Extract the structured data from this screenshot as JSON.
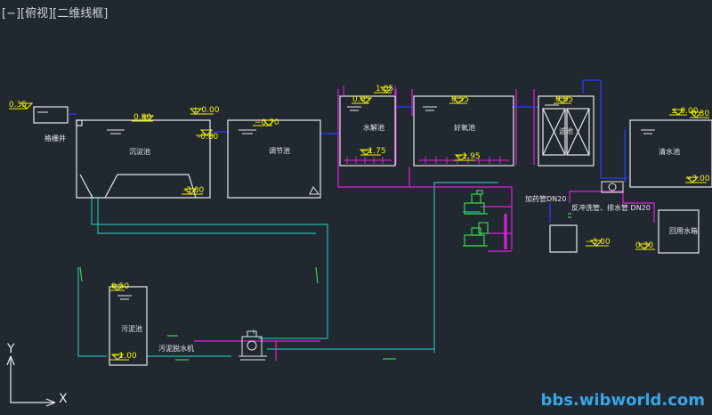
{
  "viewport": {
    "label": "[−][俯视][二维线框]"
  },
  "watermark": "bbs.wibworld.com",
  "ucs": {
    "x_label": "X",
    "y_label": "Y"
  },
  "colors": {
    "background": "#212830",
    "outline": "#e8e8e8",
    "elevation": "#f2f20a",
    "pipe_cyan": "#22b8b0",
    "pipe_magenta": "#e020e0",
    "pipe_blue": "#2a3cff",
    "pump_green": "#39d24a",
    "watermark": "#37a6e6"
  },
  "tanks": {
    "grille": {
      "label": "格栅井",
      "level": "0.35"
    },
    "sedimentation": {
      "label": "沉淀池",
      "top": "0.80",
      "low_a": "-0.80",
      "low_b": "± 0.00",
      "bottom": "-3.80"
    },
    "regulating": {
      "label": "调节池",
      "top": "−0.70"
    },
    "hydrolysis": {
      "label": "水解池",
      "top": "1.05",
      "inner": "0.05",
      "bottom": "−1.75"
    },
    "aerobic": {
      "label": "好氧池",
      "top": "0.55",
      "bottom": "−1.95"
    },
    "filter": {
      "label": "滤池",
      "top": "0.85"
    },
    "clear_water": {
      "label": "清水池",
      "top": "± 0.00",
      "top2": "0.30",
      "bottom": "−3.00"
    },
    "sludge": {
      "label": "污泥池",
      "top": "0.50",
      "bottom": "−1.00"
    },
    "dosing": {
      "level": "−3.00"
    },
    "reuse": {
      "label": "回用水箱",
      "level": "0.30"
    }
  },
  "notes": {
    "sludge_dewatering": "污泥脱水机",
    "dosing_pipe": "加药管DN20",
    "backwash_pipe": "反冲洗管、排水管 DN20"
  }
}
